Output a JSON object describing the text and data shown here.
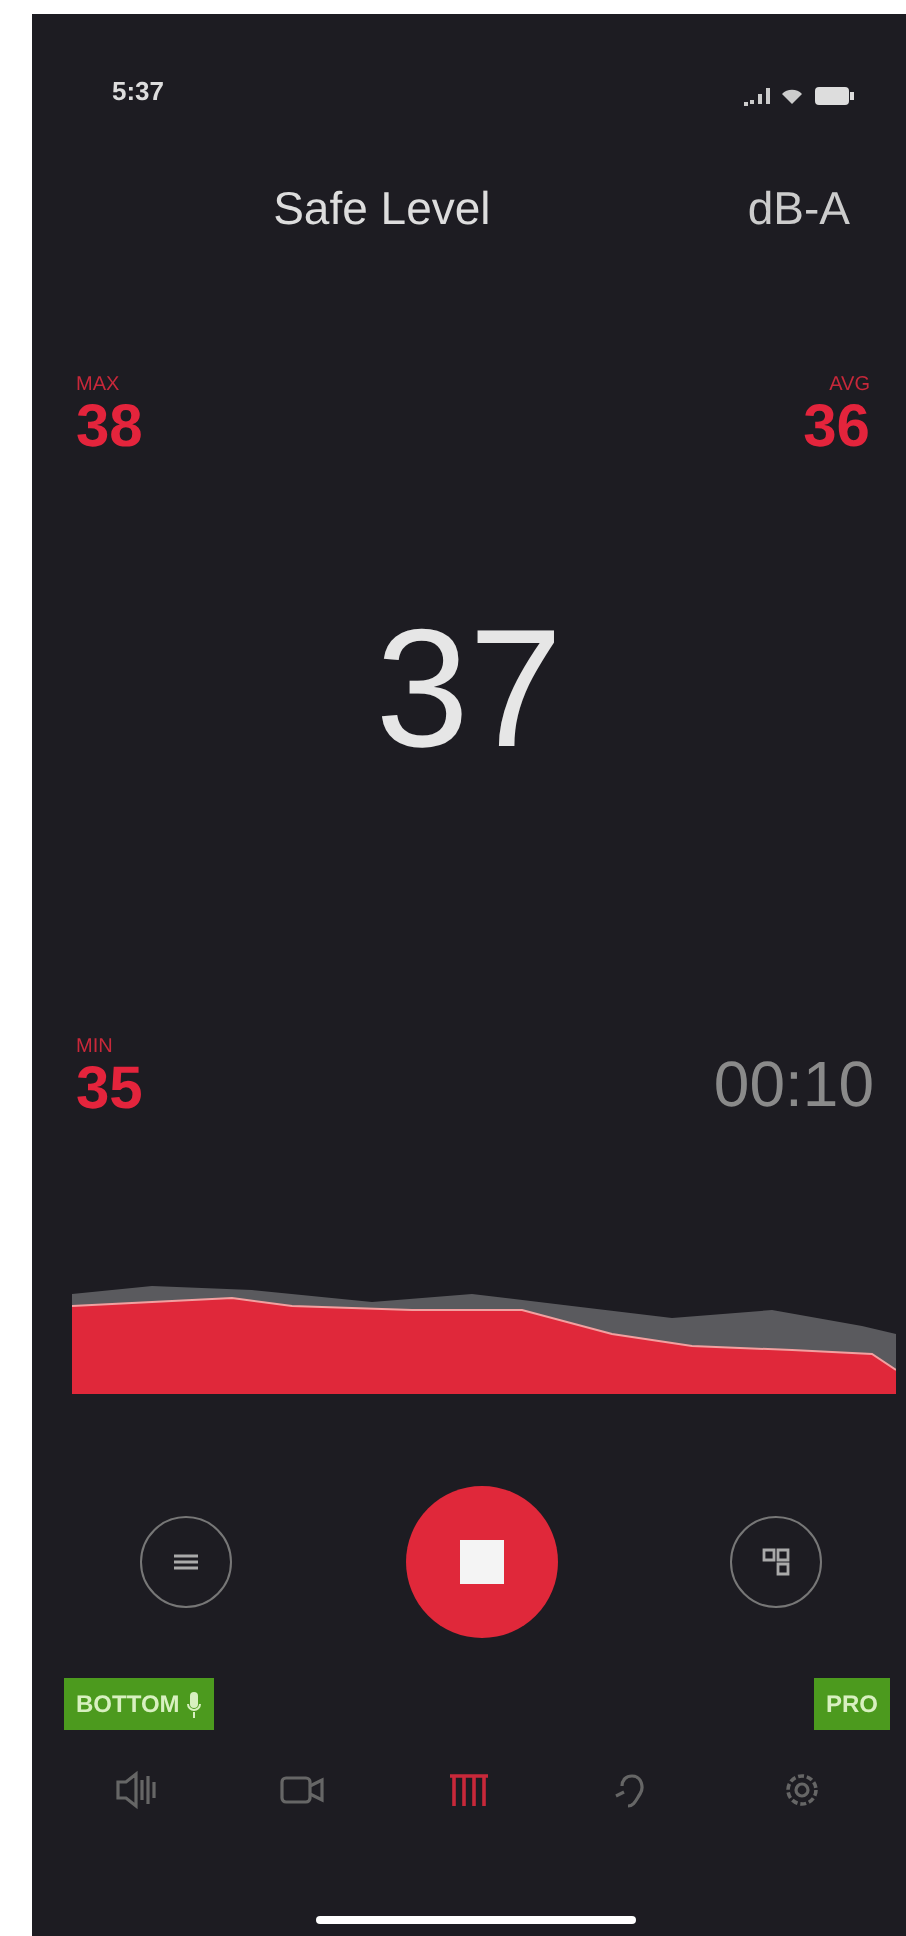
{
  "status_bar": {
    "time": "5:37"
  },
  "header": {
    "title": "Safe Level",
    "weighting": "dB-A"
  },
  "stats": [
    {
      "kind": "max",
      "label": "MAX",
      "value": "38"
    },
    {
      "kind": "avg",
      "label": "AVG",
      "value": "36"
    },
    {
      "kind": "min",
      "label": "MIN",
      "value": "35"
    }
  ],
  "reading": "37",
  "elapsed": "00:10",
  "badges": [
    {
      "kind": "mic",
      "label": "BOTTOM"
    },
    {
      "kind": "plain",
      "label": "PRO"
    }
  ],
  "tabs": [
    {
      "kind": "speaker",
      "selected": false
    },
    {
      "kind": "camera",
      "selected": false
    },
    {
      "kind": "meter",
      "selected": true
    },
    {
      "kind": "ear",
      "selected": false
    },
    {
      "kind": "gear",
      "selected": false
    }
  ]
}
